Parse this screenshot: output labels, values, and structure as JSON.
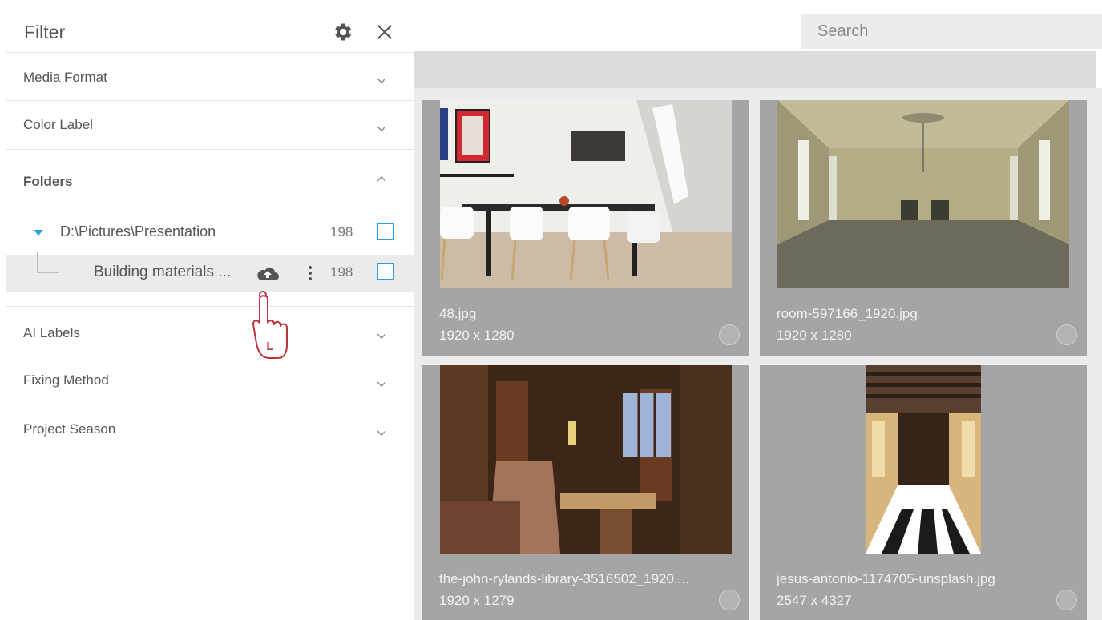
{
  "panel": {
    "title": "Filter",
    "sections": {
      "media_format": "Media Format",
      "color_label": "Color Label",
      "folders": "Folders",
      "ai_labels": "AI Labels",
      "fixing_method": "Fixing Method",
      "project_season": "Project Season"
    },
    "folder_tree": {
      "root": {
        "label": "D:\\Pictures\\Presentation",
        "count": "198"
      },
      "child": {
        "label": "Building materials ...",
        "count": "198"
      }
    },
    "icons": {
      "settings": "gear-icon",
      "close": "close-icon",
      "expand": "chevron-down-icon",
      "collapse": "chevron-up-icon",
      "upload": "cloud-upload-icon",
      "more": "more-vertical-icon",
      "cursor": "hand-cursor-icon"
    },
    "cursor_label": "L"
  },
  "search": {
    "placeholder": "Search"
  },
  "images": [
    {
      "name": "48.jpg",
      "dims": "1920 x 1280"
    },
    {
      "name": "room-597166_1920.jpg",
      "dims": "1920 x 1280"
    },
    {
      "name": "the-john-rylands-library-3516502_1920....",
      "dims": "1920 x 1279"
    },
    {
      "name": "jesus-antonio-1174705-unsplash.jpg",
      "dims": "2547 x 4327"
    }
  ],
  "colors": {
    "accent": "#29a0dd",
    "cursor": "#c0303a"
  }
}
